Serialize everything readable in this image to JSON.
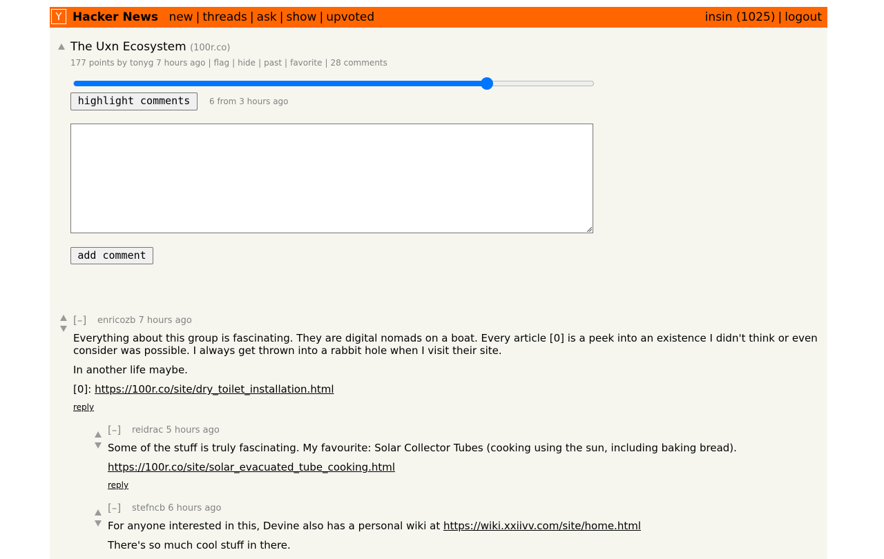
{
  "header": {
    "logo": "Y",
    "brand": "Hacker News",
    "nav": [
      "new",
      "threads",
      "ask",
      "show",
      "upvoted"
    ],
    "user": "insin",
    "karma": "(1025)",
    "logout": "logout"
  },
  "colors": {
    "header_bg": "#ff6600",
    "page_bg": "#f6f6ef",
    "slider_accent": "#0075ff",
    "meta_gray": "#828282"
  },
  "story": {
    "title": "The Uxn Ecosystem",
    "site": "(100r.co)",
    "points": "177 points",
    "by": "by",
    "author": "tonyg",
    "age": "7 hours ago",
    "actions": [
      "flag",
      "hide",
      "past",
      "favorite",
      "28 comments"
    ]
  },
  "highlight": {
    "slider_fraction": 0.795,
    "button": "highlight comments",
    "info": "6 from 3 hours ago"
  },
  "comment_form": {
    "textarea_value": "",
    "submit": "add comment"
  },
  "comments": [
    {
      "toggle": "[–]",
      "author": "enricozb",
      "age": "7 hours ago",
      "p1": "Everything about this group is fascinating. They are digital nomads on a boat. Every article [0] is a peek into an existence I didn't think or even consider was possible. I always get thrown into a rabbit hole when I visit their site.",
      "p2": "In another life maybe.",
      "p3_prefix": "[0]: ",
      "p3_link": "https://100r.co/site/dry_toilet_installation.html",
      "reply": "reply"
    },
    {
      "toggle": "[–]",
      "author": "reidrac",
      "age": "5 hours ago",
      "p1": "Some of the stuff is truly fascinating. My favourite: Solar Collector Tubes (cooking using the sun, including baking bread).",
      "p2_link": "https://100r.co/site/solar_evacuated_tube_cooking.html",
      "reply": "reply"
    },
    {
      "toggle": "[–]",
      "author": "stefncb",
      "age": "6 hours ago",
      "p1_prefix": "For anyone interested in this, Devine also has a personal wiki at ",
      "p1_link": "https://wiki.xxiivv.com/site/home.html",
      "p2": "There's so much cool stuff in there."
    }
  ]
}
